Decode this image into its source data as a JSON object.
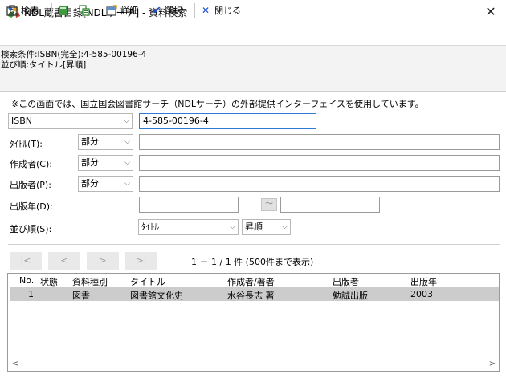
{
  "window": {
    "title": "NDL蔵書目録[NDLサーチ] - 資料検索",
    "close_glyph": "✕"
  },
  "toolbar": {
    "search_label": "検索",
    "detail_label": "詳細",
    "select_label": "選択",
    "close_label": "閉じる",
    "select_glyph": "✔",
    "close_glyph": "✕"
  },
  "conditions": {
    "line1": "検索条件:ISBN(完全):4-585-00196-4",
    "line2": "並び順:タイトル[昇順]"
  },
  "note": "※この画面では、国立国会図書館サーチ（NDLサーチ）の外部提供インターフェイスを使用しています。",
  "form": {
    "key_field": {
      "selected": "ISBN",
      "value": "4-585-00196-4"
    },
    "title": {
      "label": "ﾀｲﾄﾙ(T):",
      "mode": "部分",
      "value": ""
    },
    "author": {
      "label": "作成者(C):",
      "mode": "部分",
      "value": ""
    },
    "publisher": {
      "label": "出版者(P):",
      "mode": "部分",
      "value": ""
    },
    "pub_year": {
      "label": "出版年(D):",
      "from": "",
      "range_glyph": "～",
      "to": ""
    },
    "sort": {
      "label": "並び順(S):",
      "field": "ﾀｲﾄﾙ",
      "order": "昇順"
    },
    "dropdown_glyph": "⌵"
  },
  "navigation": {
    "first": "|<",
    "prev": "<",
    "next": ">",
    "last": ">|",
    "range_text": "1 － 1 / 1 件 (500件まで表示)"
  },
  "results": {
    "columns": [
      "No.",
      "状態",
      "資料種別",
      "タイトル",
      "作成者/著者",
      "出版者",
      "出版年"
    ],
    "rows": [
      {
        "no": "1",
        "status": "",
        "type": "図書",
        "title": "図書館文化史",
        "author": "水谷長志 著",
        "publisher": "勉誠出版",
        "year": "2003"
      }
    ],
    "scroll_left": "<",
    "scroll_right": ">"
  },
  "colors": {
    "selected_row": "#cccccc",
    "focus_border": "#2f7ad6",
    "toolbar_close": "#1a4fd6"
  }
}
